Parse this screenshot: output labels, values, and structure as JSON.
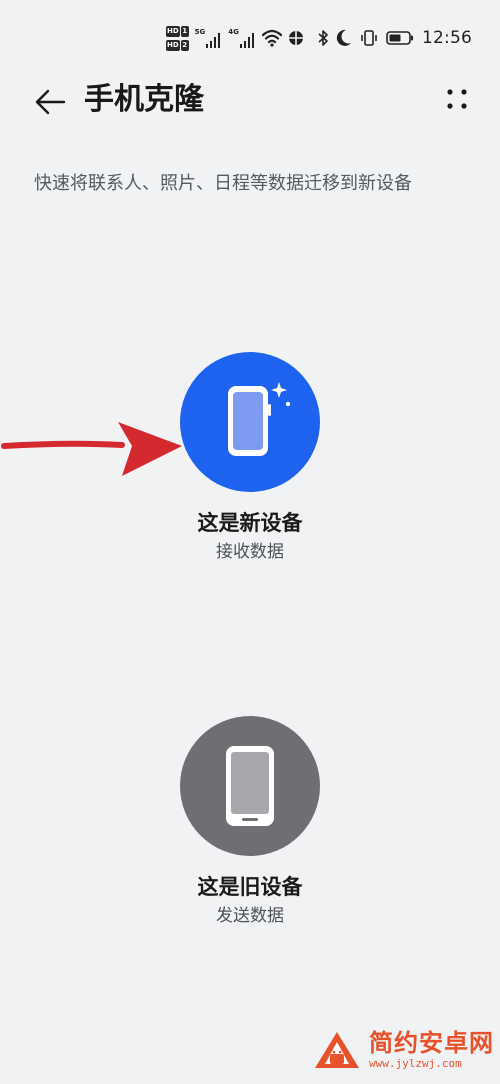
{
  "status_bar": {
    "sim1_label": "HD",
    "sim1_index": "1",
    "sim2_label": "HD",
    "sim2_index": "2",
    "network1": "5G",
    "network2": "4G",
    "time": "12:56",
    "icons": [
      "wifi-icon",
      "data-saver-icon",
      "bluetooth-icon",
      "moon-icon",
      "vibrate-icon",
      "battery-icon"
    ]
  },
  "app_bar": {
    "title": "手机克隆",
    "back_icon": "back-arrow-icon",
    "more_icon": "more-dots-icon"
  },
  "subtitle": "快速将联系人、照片、日程等数据迁移到新设备",
  "options": {
    "new_device": {
      "label": "这是新设备",
      "sub": "接收数据",
      "color": "#1d63ef",
      "icon": "new-phone-sparkle-icon"
    },
    "old_device": {
      "label": "这是旧设备",
      "sub": "发送数据",
      "color": "#6d6f73",
      "icon": "old-phone-icon"
    }
  },
  "annotation": {
    "color": "#d42a2f",
    "icon": "red-arrow-icon"
  },
  "watermark": {
    "title": "简约安卓网",
    "url": "www.jylzwj.com",
    "color": "#e8522b",
    "icon": "android-logo-icon"
  }
}
